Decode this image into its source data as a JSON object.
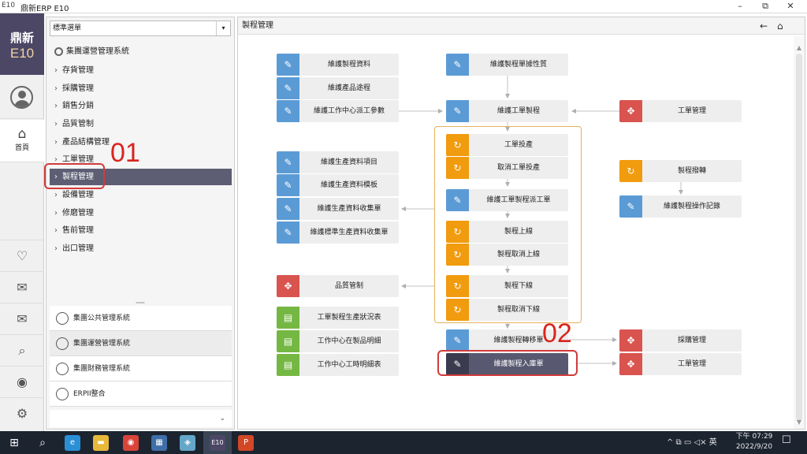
{
  "window": {
    "logo_text": "E10",
    "title": "鼎新ERP E10",
    "min_glyph": "–",
    "max_glyph": "⧉",
    "close_glyph": "✕"
  },
  "rail": {
    "brand_line1": "鼎新",
    "brand_line2": "E10",
    "home_label": "首頁",
    "home_glyph": "⌂",
    "icons": [
      {
        "name": "favorites-heart-icon",
        "glyph": "♡"
      },
      {
        "name": "mail-icon",
        "glyph": "✉"
      },
      {
        "name": "mail-forward-icon",
        "glyph": "✉"
      },
      {
        "name": "search-icon",
        "glyph": "⌕"
      },
      {
        "name": "user-settings-icon",
        "glyph": "◉"
      },
      {
        "name": "gear-icon",
        "glyph": "⚙"
      }
    ]
  },
  "menu": {
    "selector_value": "標準選單",
    "selector_caret": "▾",
    "system_title": "集團運營管理系統",
    "chevron": "›",
    "items": [
      {
        "label": "存貨管理"
      },
      {
        "label": "採購管理"
      },
      {
        "label": "銷售分銷"
      },
      {
        "label": "品質管制"
      },
      {
        "label": "產品結構管理"
      },
      {
        "label": "工單管理"
      },
      {
        "label": "製程管理"
      },
      {
        "label": "設備管理"
      },
      {
        "label": "修磨管理"
      },
      {
        "label": "售前管理"
      },
      {
        "label": "出口管理"
      }
    ],
    "splitter_glyph": "═══",
    "systems": [
      {
        "label": "集團公共管理系統"
      },
      {
        "label": "集團運營管理系統"
      },
      {
        "label": "集團財務管理系統"
      },
      {
        "label": "ERPII整合"
      }
    ],
    "more_glyph": "⌄"
  },
  "main": {
    "title": "製程管理",
    "back_glyph": "←",
    "home_glyph": "⌂",
    "scroll_up": "▲",
    "scroll_down": "▼"
  },
  "icon_glyphs": {
    "edit": "✎",
    "move": "✥",
    "cycle": "↻",
    "report": "▤"
  },
  "flow": {
    "nodes": [
      {
        "id": "n1",
        "label": "維護製程資料",
        "icon": "edit",
        "color": "#5b9bd5"
      },
      {
        "id": "n2",
        "label": "維護產品途程",
        "icon": "edit",
        "color": "#5b9bd5"
      },
      {
        "id": "n3",
        "label": "維護工作中心派工參數",
        "icon": "edit",
        "color": "#5b9bd5"
      },
      {
        "id": "n4",
        "label": "維護製程單據性質",
        "icon": "edit",
        "color": "#5b9bd5"
      },
      {
        "id": "n5",
        "label": "維護工單製程",
        "icon": "edit",
        "color": "#5b9bd5"
      },
      {
        "id": "n6",
        "label": "工單管理",
        "icon": "move",
        "color": "#d9534f"
      },
      {
        "id": "n7",
        "label": "工單投產",
        "icon": "cycle",
        "color": "#f19b0e"
      },
      {
        "id": "n8",
        "label": "取消工單投產",
        "icon": "cycle",
        "color": "#f19b0e"
      },
      {
        "id": "n9",
        "label": "維護工單製程派工單",
        "icon": "edit",
        "color": "#5b9bd5"
      },
      {
        "id": "n10",
        "label": "製程上線",
        "icon": "cycle",
        "color": "#f19b0e"
      },
      {
        "id": "n11",
        "label": "製程取消上線",
        "icon": "cycle",
        "color": "#f19b0e"
      },
      {
        "id": "n12",
        "label": "製程下線",
        "icon": "cycle",
        "color": "#f19b0e"
      },
      {
        "id": "n13",
        "label": "製程取消下線",
        "icon": "cycle",
        "color": "#f19b0e"
      },
      {
        "id": "n14",
        "label": "維護生產資料項目",
        "icon": "edit",
        "color": "#5b9bd5"
      },
      {
        "id": "n15",
        "label": "維護生產資料模板",
        "icon": "edit",
        "color": "#5b9bd5"
      },
      {
        "id": "n16",
        "label": "維護生產資料收集單",
        "icon": "edit",
        "color": "#5b9bd5"
      },
      {
        "id": "n17",
        "label": "維護標準生產資料收集單",
        "icon": "edit",
        "color": "#5b9bd5"
      },
      {
        "id": "n18",
        "label": "製程撥轉",
        "icon": "cycle",
        "color": "#f19b0e"
      },
      {
        "id": "n19",
        "label": "維護製程操作記錄",
        "icon": "edit",
        "color": "#5b9bd5"
      },
      {
        "id": "n20",
        "label": "品質管制",
        "icon": "move",
        "color": "#d9534f"
      },
      {
        "id": "n21",
        "label": "工單製程生產狀況表",
        "icon": "report",
        "color": "#75b743"
      },
      {
        "id": "n22",
        "label": "工作中心在製品明細",
        "icon": "report",
        "color": "#75b743"
      },
      {
        "id": "n23",
        "label": "工作中心工時明細表",
        "icon": "report",
        "color": "#75b743"
      },
      {
        "id": "n24",
        "label": "維護製程轉移單",
        "icon": "edit",
        "color": "#5b9bd5"
      },
      {
        "id": "n25",
        "label": "維護製程入庫單",
        "icon": "edit",
        "color": "#3b3b50"
      },
      {
        "id": "n26",
        "label": "採購管理",
        "icon": "move",
        "color": "#d9534f"
      },
      {
        "id": "n27",
        "label": "工單管理",
        "icon": "move",
        "color": "#d9534f"
      }
    ]
  },
  "annotations": {
    "callout_01": "01",
    "callout_02": "02"
  },
  "taskbar": {
    "start_glyph": "⊞",
    "search_glyph": "⌕",
    "apps": [
      {
        "name": "edge-browser-icon",
        "glyph": "e",
        "color": "#2b8fd6"
      },
      {
        "name": "file-explorer-icon",
        "glyph": "▬",
        "color": "#e8b83a"
      },
      {
        "name": "chrome-browser-icon",
        "glyph": "◉",
        "color": "#d9443a"
      },
      {
        "name": "calculator-icon",
        "glyph": "▦",
        "color": "#3e6fa8"
      },
      {
        "name": "notes-app-icon",
        "glyph": "◈",
        "color": "#64a7c8"
      },
      {
        "name": "erp-e10-icon",
        "glyph": "E10",
        "color": "#4d4766"
      },
      {
        "name": "powerpoint-icon",
        "glyph": "P",
        "color": "#d24726"
      }
    ],
    "tray_text": "^  ⧉  ▭  ◁×  英",
    "time": "下午 07:29",
    "date": "2022/9/20",
    "notify_glyph": "☐"
  }
}
